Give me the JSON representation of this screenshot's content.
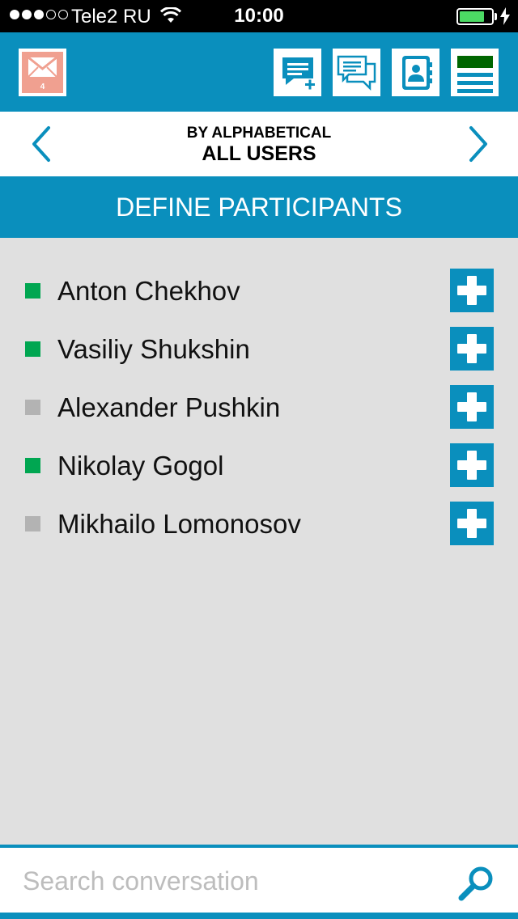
{
  "status_bar": {
    "carrier": "Tele2 RU",
    "time": "10:00",
    "signal_filled": 3,
    "signal_total": 5,
    "battery_level": 0.8
  },
  "toolbar": {
    "mail_count": "4",
    "icons": [
      "mail-icon",
      "new-message-icon",
      "chat-icon",
      "contacts-icon",
      "menu-icon"
    ]
  },
  "category": {
    "subtitle": "BY ALPHABETICAL",
    "title": "ALL USERS"
  },
  "section": {
    "title": "DEFINE PARTICIPANTS"
  },
  "participants": [
    {
      "name": "Anton Chekhov",
      "status_color": "#00a651"
    },
    {
      "name": "Vasiliy Shukshin",
      "status_color": "#00a651"
    },
    {
      "name": "Alexander Pushkin",
      "status_color": "#b3b3b3"
    },
    {
      "name": "Nikolay Gogol",
      "status_color": "#00a651"
    },
    {
      "name": "Mikhailo Lomonosov",
      "status_color": "#b3b3b3"
    }
  ],
  "search": {
    "placeholder": "Search conversation",
    "value": ""
  },
  "colors": {
    "accent": "#0a8fbd",
    "online": "#00a651",
    "offline": "#b3b3b3",
    "background": "#e0e0e0"
  }
}
